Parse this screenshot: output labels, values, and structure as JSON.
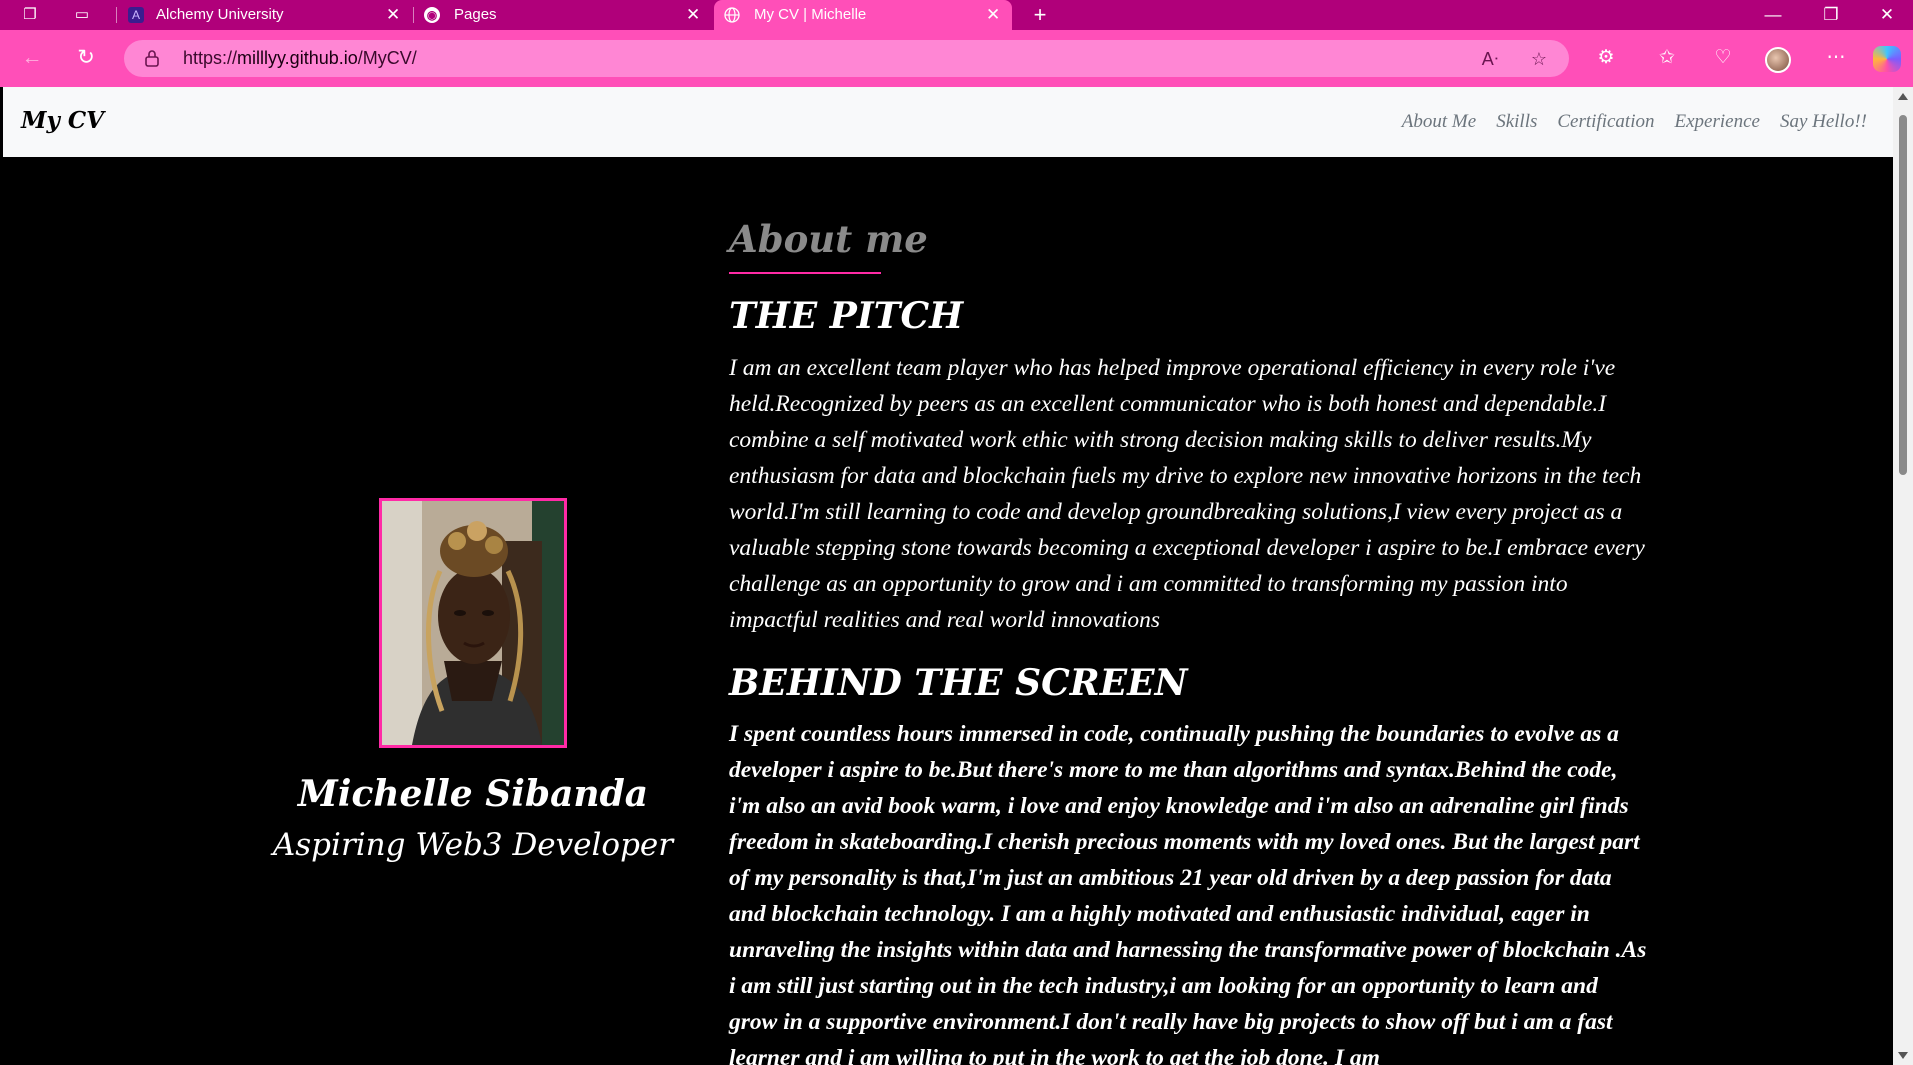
{
  "browser": {
    "tabs": [
      {
        "title": "Alchemy University",
        "icon": "alchemy-icon"
      },
      {
        "title": "Pages",
        "icon": "github-icon"
      },
      {
        "title": "My CV | Michelle",
        "icon": "globe-icon",
        "active": true
      }
    ],
    "url_prefix": "https://",
    "url_host": "milllyy.github.io",
    "url_path": "/MyCV/",
    "accent_color": "#ff4fb8",
    "tabbar_color": "#b0007a"
  },
  "site": {
    "brand": "My CV",
    "nav": [
      "About Me",
      "Skills",
      "Certification",
      "Experience",
      "Say Hello!!"
    ]
  },
  "profile": {
    "name": "Michelle Sibanda",
    "role": "Aspiring Web3 Developer"
  },
  "about": {
    "title": "About me",
    "pitch_heading": "THE PITCH",
    "pitch_text": "I am an excellent team player who has helped improve operational efficiency in every role i've held.Recognized by peers as an excellent communicator who is both honest and dependable.I combine a self motivated work ethic with strong decision making skills to deliver results.My enthusiasm for data and blockchain fuels my drive to explore new innovative horizons in the tech world.I'm still learning to code and develop groundbreaking solutions,I view every project as a valuable stepping stone towards becoming a exceptional developer i aspire to be.I embrace every challenge as an opportunity to grow and i am committed to transforming my passion into impactful realities and real world innovations",
    "behind_heading": "BEHIND THE SCREEN",
    "behind_text": "I spent countless hours immersed in code, continually pushing the boundaries to evolve as a developer i aspire to be.But there's more to me than algorithms and syntax.Behind the code, i'm also an avid book warm, i love and enjoy knowledge and i'm also an adrenaline girl finds freedom in skateboarding.I cherish precious moments with my loved ones. But the largest part of my personality is that,I'm just an ambitious 21 year old driven by a deep passion for data and blockchain technology. I am a highly motivated and enthusiastic individual, eager in unraveling the insights within data and harnessing the transformative power of blockchain .As i am still just starting out in the tech industry,i am looking for an opportunity to learn and grow in a supportive environment.I don't really have big projects to show off but i am a fast learner and i am willing to put in the work to get the job done. I am"
  }
}
